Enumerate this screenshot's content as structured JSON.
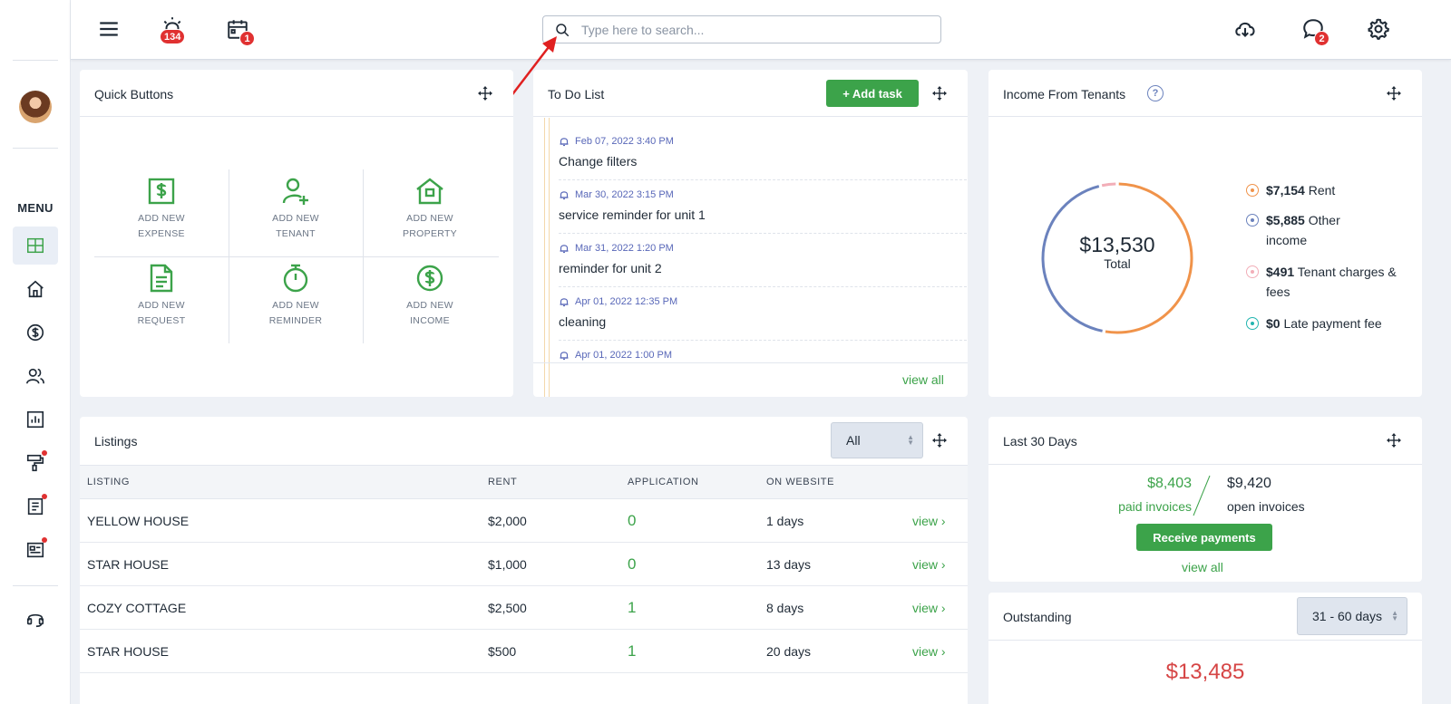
{
  "header": {
    "alerts_badge": "134",
    "calendar_badge": "1",
    "messages_badge": "2",
    "search_placeholder": "Type here to search..."
  },
  "sidebar": {
    "menu_label": "MENU",
    "items": [
      {
        "icon": "dashboard-icon",
        "active": true
      },
      {
        "icon": "home-icon"
      },
      {
        "icon": "dollar-icon"
      },
      {
        "icon": "users-icon"
      },
      {
        "icon": "reports-icon"
      },
      {
        "icon": "paint-roller-icon",
        "dot": true
      },
      {
        "icon": "document-icon",
        "dot": true
      },
      {
        "icon": "listing-icon",
        "dot": true
      },
      {
        "icon": "support-icon"
      }
    ]
  },
  "quick_buttons": {
    "title": "Quick Buttons",
    "items": [
      {
        "label": "ADD NEW\nEXPENSE",
        "icon": "expense-icon"
      },
      {
        "label": "ADD NEW\nTENANT",
        "icon": "add-tenant-icon"
      },
      {
        "label": "ADD NEW\nPROPERTY",
        "icon": "property-icon"
      },
      {
        "label": "ADD NEW\nREQUEST",
        "icon": "request-icon"
      },
      {
        "label": "ADD NEW\nREMINDER",
        "icon": "stopwatch-icon"
      },
      {
        "label": "ADD NEW\nINCOME",
        "icon": "income-icon"
      }
    ]
  },
  "todo": {
    "title": "To Do List",
    "add_label": "+ Add task",
    "view_all": "view all",
    "items": [
      {
        "date": "Feb 07, 2022 3:40 PM",
        "text": "Change filters"
      },
      {
        "date": "Mar 30, 2022 3:15 PM",
        "text": "service reminder for unit 1"
      },
      {
        "date": "Mar 31, 2022 1:20 PM",
        "text": "reminder for unit 2"
      },
      {
        "date": "Apr 01, 2022 12:35 PM",
        "text": "cleaning"
      },
      {
        "date": "Apr 01, 2022 1:00 PM",
        "text": ""
      }
    ]
  },
  "income": {
    "title": "Income From Tenants",
    "total": "$13,530",
    "total_label": "Total",
    "legend": [
      {
        "amount": "$7,154",
        "label": "Rent",
        "color": "#f0934a"
      },
      {
        "amount": "$5,885",
        "label": "Other income",
        "color": "#6b82bd"
      },
      {
        "amount": "$491",
        "label": "Tenant charges & fees",
        "color": "#f2aeb8"
      },
      {
        "amount": "$0",
        "label": "Late payment fee",
        "color": "#23b5b0"
      }
    ]
  },
  "listings": {
    "title": "Listings",
    "filter": "All",
    "columns": [
      "LISTING",
      "RENT",
      "APPLICATION",
      "ON WEBSITE"
    ],
    "rows": [
      {
        "listing": "YELLOW HOUSE",
        "rent": "$2,000",
        "application": "0",
        "on_website": "1 days",
        "action": "view"
      },
      {
        "listing": "STAR HOUSE",
        "rent": "$1,000",
        "application": "0",
        "on_website": "13 days",
        "action": "view"
      },
      {
        "listing": "COZY COTTAGE",
        "rent": "$2,500",
        "application": "1",
        "on_website": "8 days",
        "action": "view"
      },
      {
        "listing": "STAR HOUSE",
        "rent": "$500",
        "application": "1",
        "on_website": "20 days",
        "action": "view"
      }
    ]
  },
  "last30": {
    "title": "Last 30 Days",
    "paid_amount": "$8,403",
    "paid_label": "paid invoices",
    "open_amount": "$9,420",
    "open_label": "open invoices",
    "receive_label": "Receive payments",
    "view_all": "view all"
  },
  "outstanding": {
    "title": "Outstanding",
    "filter": "31 - 60 days",
    "amount": "$13,485"
  },
  "colors": {
    "accent_green": "#3ca34a",
    "badge_red": "#e03131",
    "outstanding_red": "#d64545"
  }
}
